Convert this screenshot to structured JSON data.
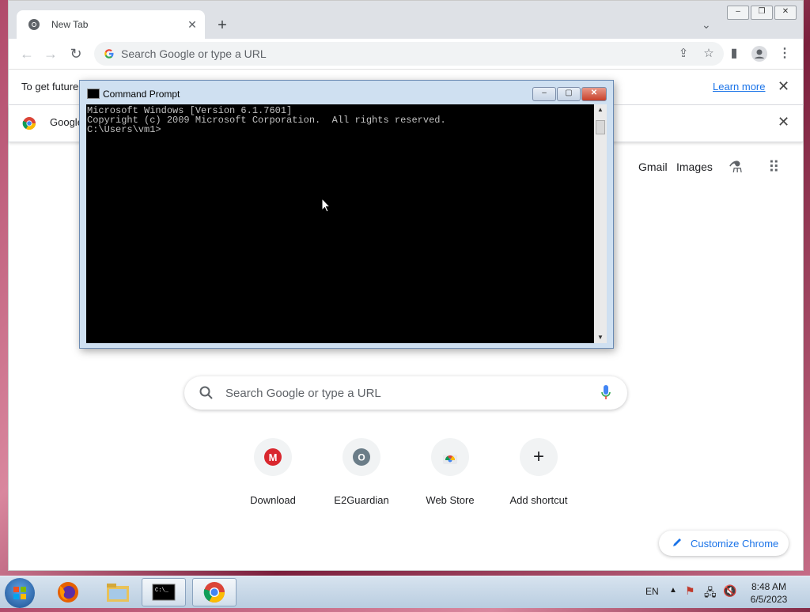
{
  "chrome": {
    "tab_title": "New Tab",
    "omnibox_placeholder": "Search Google or type a URL",
    "infobar1_text": "To get future",
    "infobar1_link": "Learn more",
    "infobar2_text": "Google",
    "ntp_links": [
      "Gmail",
      "Images"
    ],
    "search_placeholder": "Search Google or type a URL",
    "shortcuts": [
      {
        "label": "Download",
        "icon": "mega-icon"
      },
      {
        "label": "E2Guardian",
        "icon": "letter-o-icon",
        "letter": "O"
      },
      {
        "label": "Web Store",
        "icon": "web-store-icon"
      },
      {
        "label": "Add shortcut",
        "icon": "plus-icon"
      }
    ],
    "customize_label": "Customize Chrome"
  },
  "cmd": {
    "title": "Command Prompt",
    "lines": [
      "Microsoft Windows [Version 6.1.7601]",
      "Copyright (c) 2009 Microsoft Corporation.  All rights reserved.",
      "",
      "C:\\Users\\vm1>"
    ]
  },
  "taskbar": {
    "apps": [
      "firefox-icon",
      "file-explorer-icon",
      "command-prompt-icon",
      "chrome-icon"
    ],
    "language": "EN",
    "time": "8:48 AM",
    "date": "6/5/2023"
  },
  "colors": {
    "chrome_blue": "#1a73e8",
    "console_bg": "#000000",
    "console_text": "#c0c0c0"
  }
}
